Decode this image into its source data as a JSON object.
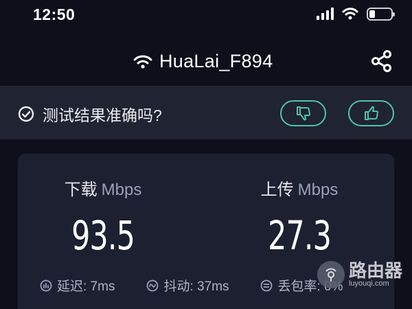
{
  "status_bar": {
    "time": "12:50",
    "battery_level": 0.25,
    "icons": [
      "signal-icon",
      "wifi-icon",
      "battery-icon"
    ]
  },
  "header": {
    "network_name": "HuaLai_F894",
    "icons": [
      "wifi-icon",
      "share-icon"
    ]
  },
  "feedback": {
    "question": "测试结果准确吗?",
    "icons": [
      "check-circle-icon",
      "thumbs-down-icon",
      "thumbs-up-icon"
    ]
  },
  "results": {
    "download": {
      "label": "下载",
      "unit": "Mbps",
      "value": "93.5"
    },
    "upload": {
      "label": "上传",
      "unit": "Mbps",
      "value": "27.3"
    },
    "stats": [
      {
        "label": "延迟: 7ms",
        "icon": "latency-icon"
      },
      {
        "label": "抖动: 37ms",
        "icon": "jitter-icon"
      },
      {
        "label": "丢包率: 0%",
        "icon": "packet-loss-icon"
      }
    ]
  },
  "watermark": {
    "name": "路由器",
    "site": "luyouqi.com"
  },
  "colors": {
    "background": "#0f0f1c",
    "accent": "#4fc5a8",
    "card": "#1d2030",
    "bar": "#202331"
  }
}
